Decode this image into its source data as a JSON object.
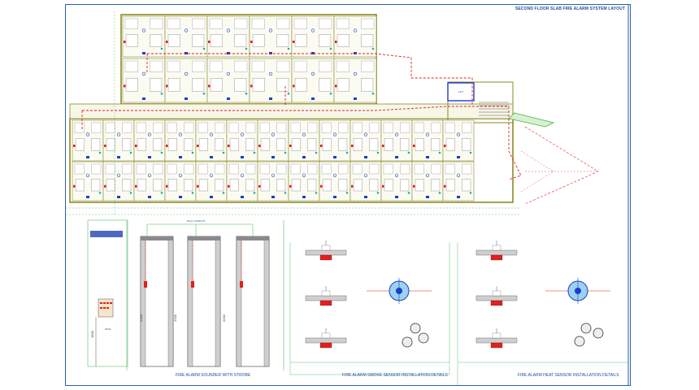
{
  "sheet": {
    "title": "SECOND FLOOR SLAB FIRE ALARM SYSTEM LAYOUT"
  },
  "plan": {
    "lift_label": "LIFT"
  },
  "details": {
    "sounder": {
      "caption": "FIRE ALARM SOUNDER WITH STROBE",
      "conduit_note": "40mm CONDUIT",
      "dim_height_1": "2100",
      "dim_height_2": "2200",
      "dim_height_3": "2200",
      "wall_label": "WALL",
      "panel_height": "1500"
    },
    "smoke": {
      "caption": "FIRE ALARM SMOKE SENSOR INSTALLATION DETAILS",
      "labels": [
        "BACK BOX",
        "40mm CONDUIT",
        "UNIVERSAL SENSOR BASE",
        "SMOKE SENSOR",
        "FLUSH TYPE BACK BOX"
      ]
    },
    "heat": {
      "caption": "FIRE ALARM HEAT SENSOR INSTALLATION DETAILS",
      "labels": [
        "BACK BOX",
        "40mm CONDUIT",
        "UNIVERSAL SENSOR BASE",
        "HEAT SENSOR",
        "FLUSH TYPE BACK BOX"
      ]
    }
  },
  "colors": {
    "wall": "#8a8a2a",
    "alarm_route": "#e02020",
    "detector": "#1a3fd0",
    "guide": "#39b54a",
    "border": "#2a5fb0"
  }
}
